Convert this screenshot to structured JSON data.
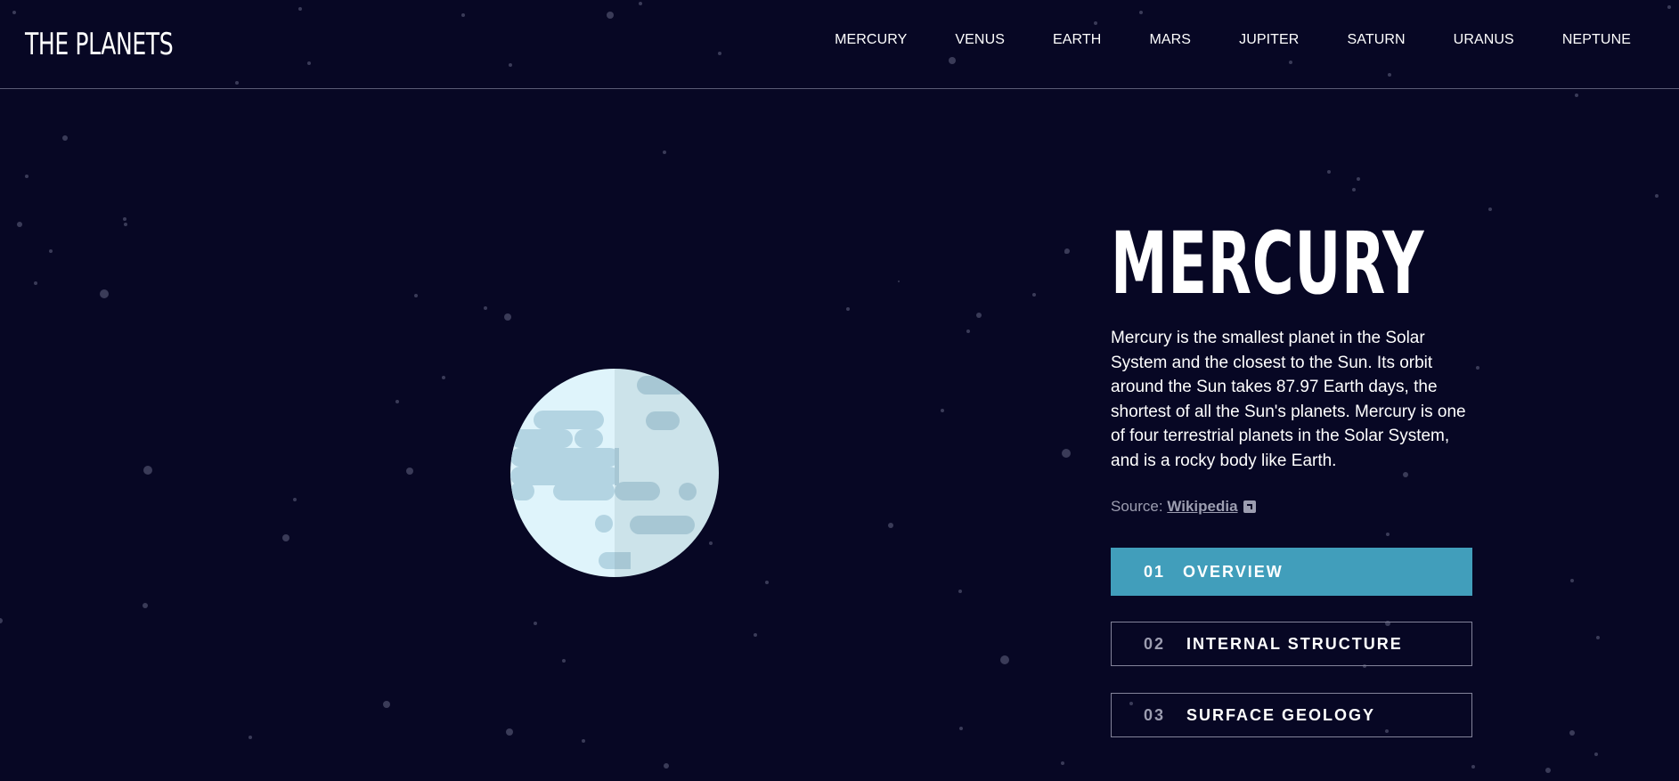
{
  "header": {
    "logo": "THE PLANETS",
    "nav": [
      "MERCURY",
      "VENUS",
      "EARTH",
      "MARS",
      "JUPITER",
      "SATURN",
      "URANUS",
      "NEPTUNE"
    ]
  },
  "planet": {
    "name": "MERCURY",
    "description": "Mercury is the smallest planet in the Solar System and the closest to the Sun. Its orbit around the Sun takes 87.97 Earth days, the shortest of all the Sun's planets. Mercury is one of four terrestrial planets in the Solar System, and is a rocky body like Earth.",
    "source_label": "Source:",
    "source_link": "Wikipedia"
  },
  "tabs": [
    {
      "num": "01",
      "label": "OVERVIEW",
      "active": true
    },
    {
      "num": "02",
      "label": "INTERNAL STRUCTURE",
      "active": false
    },
    {
      "num": "03",
      "label": "SURFACE GEOLOGY",
      "active": false
    }
  ],
  "colors": {
    "background": "#070724",
    "accent": "#419ebb",
    "muted_text": "#9c9db0",
    "border": "#83839a"
  },
  "icons": {
    "external_link": "external-link-icon",
    "planet": "mercury-planet-icon"
  }
}
